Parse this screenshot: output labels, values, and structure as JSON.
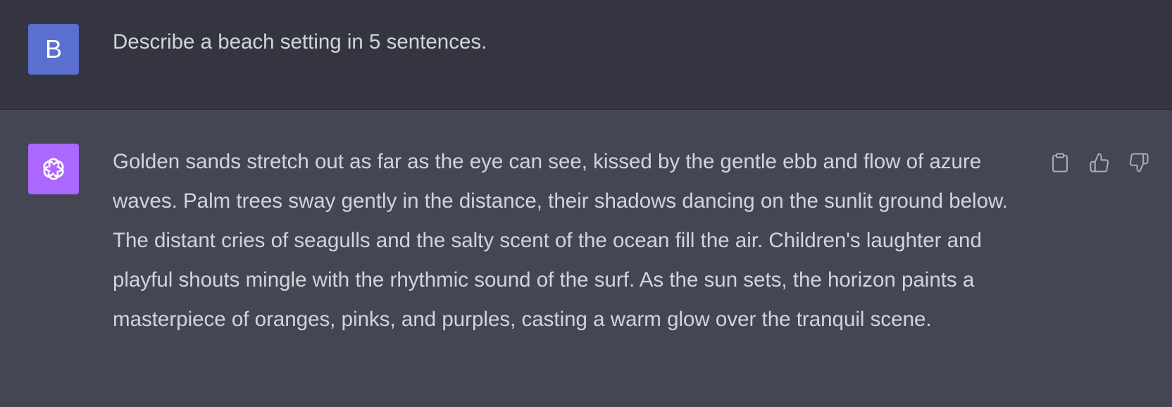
{
  "user_message": {
    "avatar_initial": "B",
    "text": "Describe a beach setting in 5 sentences."
  },
  "assistant_message": {
    "avatar_icon": "openai-logo-icon",
    "text": "Golden sands stretch out as far as the eye can see, kissed by the gentle ebb and flow of azure waves. Palm trees sway gently in the distance, their shadows dancing on the sunlit ground below. The distant cries of seagulls and the salty scent of the ocean fill the air. Children's laughter and playful shouts mingle with the rhythmic sound of the surf. As the sun sets, the horizon paints a masterpiece of oranges, pinks, and purples, casting a warm glow over the tranquil scene.",
    "actions": [
      "copy-icon",
      "thumbs-up-icon",
      "thumbs-down-icon"
    ]
  },
  "colors": {
    "user_bg": "#343541",
    "assistant_bg": "#444654",
    "user_avatar": "#5a6fcf",
    "assistant_avatar": "#ab68ff",
    "text": "#d1d5db",
    "icon": "#acacbe"
  }
}
